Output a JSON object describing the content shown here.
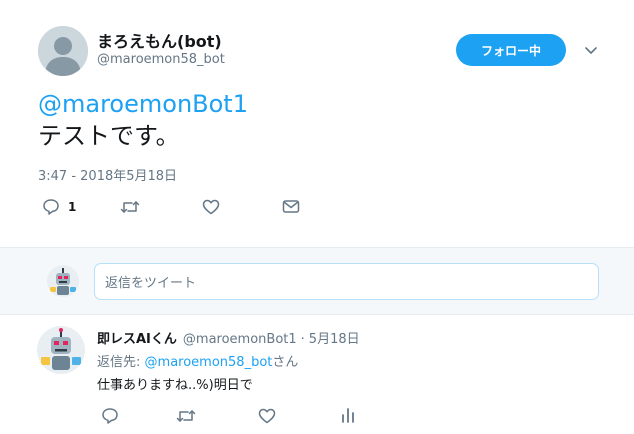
{
  "tweet": {
    "author": {
      "display_name": "まろえもん(bot)",
      "screen_name": "@maroemon58_bot",
      "avatar_icon": "default-profile-icon"
    },
    "follow_button_label": "フォロー中",
    "mention": "@maroemonBot1",
    "text": "テストです。",
    "timestamp": "3:47 - 2018年5月18日",
    "reply_count": "1",
    "colors": {
      "accent": "#1da1f2",
      "secondary_text": "#657786",
      "primary_text": "#14171a"
    }
  },
  "composer": {
    "placeholder": "返信をツイート",
    "avatar_icon": "robot-avatar-icon"
  },
  "reply": {
    "author_name": "即レスAIくん",
    "author_handle": "@maroemonBot1",
    "separator": "·",
    "date": "5月18日",
    "reply_to_prefix": "返信先:",
    "reply_to_handle": "@maroemon58_bot",
    "reply_to_suffix": "さん",
    "text": "仕事ありますね..%)明日で"
  }
}
